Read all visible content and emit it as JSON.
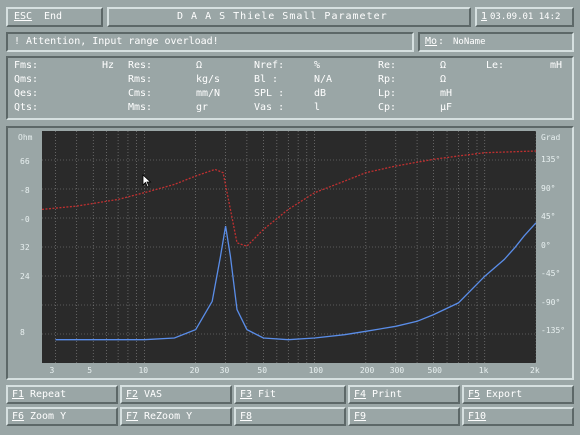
{
  "header": {
    "esc_key": "ESC",
    "esc_label": "End",
    "title": "D A A S  Thiele Small Parameter",
    "date_key": "1",
    "date_text": "03.09.01 14:2"
  },
  "status": {
    "message": "! Attention, Input range overload!",
    "model_key": "Mo",
    "model_label": ":",
    "model_value": "NoName"
  },
  "params": {
    "rows": [
      [
        {
          "label": "Fms:",
          "unit": "Hz"
        },
        {
          "label": "Res:",
          "unit": "Ω"
        },
        {
          "label": "Nref:",
          "unit": "%"
        },
        {
          "label": "Re:",
          "unit": "Ω"
        },
        {
          "label": "Le:",
          "unit": "mH"
        }
      ],
      [
        {
          "label": "Qms:",
          "unit": ""
        },
        {
          "label": "Rms:",
          "unit": "kg/s"
        },
        {
          "label": "Bl :",
          "unit": "N/A"
        },
        {
          "label": "Rp:",
          "unit": "Ω"
        }
      ],
      [
        {
          "label": "Qes:",
          "unit": ""
        },
        {
          "label": "Cms:",
          "unit": "mm/N"
        },
        {
          "label": "SPL :",
          "unit": "dB"
        },
        {
          "label": "Lp:",
          "unit": "mH"
        }
      ],
      [
        {
          "label": "Qts:",
          "unit": ""
        },
        {
          "label": "Mms:",
          "unit": "gr"
        },
        {
          "label": "Vas :",
          "unit": "l"
        },
        {
          "label": "Cp:",
          "unit": "µF"
        }
      ]
    ]
  },
  "chart_data": {
    "type": "line",
    "x_axis": {
      "scale": "log",
      "ticks": [
        "3",
        "5",
        "10",
        "20",
        "30",
        "50",
        "100",
        "200",
        "300",
        "500",
        "1k",
        "2k"
      ]
    },
    "y_left": {
      "unit": "Ohm",
      "ticks": [
        "66",
        "-8",
        "-0",
        "32",
        "24",
        "8"
      ]
    },
    "y_right": {
      "unit": "Grad",
      "ticks": [
        "135°",
        "90°",
        "45°",
        "0°",
        "-45°",
        "-90°",
        "-135°"
      ]
    },
    "grid": true,
    "series": [
      {
        "color": "#5a8de8",
        "x": [
          3,
          5,
          10,
          15,
          20,
          25,
          28,
          30,
          32,
          35,
          40,
          50,
          70,
          100,
          150,
          200,
          300,
          400,
          500,
          700,
          1000,
          1300,
          1500,
          1700,
          2000
        ],
        "y": [
          2,
          2,
          2,
          3,
          8,
          25,
          52,
          70,
          52,
          20,
          8,
          3,
          2,
          3,
          5,
          7,
          10,
          13,
          17,
          24,
          40,
          50,
          57,
          64,
          72
        ]
      },
      {
        "color": "#c03030",
        "x": [
          2.5,
          4,
          7,
          10,
          15,
          20,
          26,
          29,
          32,
          35,
          40,
          50,
          70,
          100,
          150,
          200,
          300,
          500,
          700,
          1000,
          2000
        ],
        "y": [
          80,
          82,
          86,
          90,
          95,
          100,
          104,
          102,
          80,
          60,
          58,
          68,
          80,
          90,
          97,
          102,
          106,
          110,
          112,
          114,
          115
        ]
      }
    ]
  },
  "fkeys": [
    {
      "key": "F1",
      "label": "Repeat"
    },
    {
      "key": "F2",
      "label": "VAS"
    },
    {
      "key": "F3",
      "label": "Fit"
    },
    {
      "key": "F4",
      "label": "Print"
    },
    {
      "key": "F5",
      "label": "Export"
    },
    {
      "key": "F6",
      "label": "Zoom Y"
    },
    {
      "key": "F7",
      "label": "ReZoom Y"
    },
    {
      "key": "F8",
      "label": ""
    },
    {
      "key": "F9",
      "label": ""
    },
    {
      "key": "F10",
      "label": ""
    }
  ]
}
